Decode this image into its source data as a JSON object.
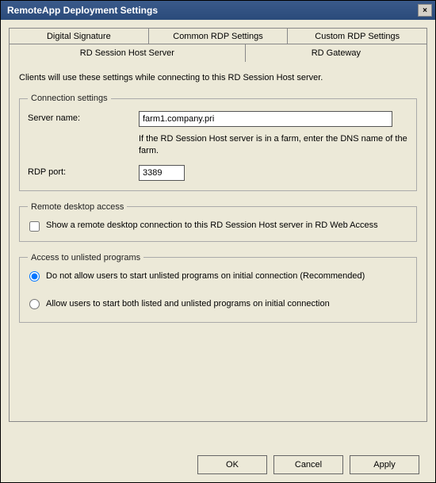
{
  "window": {
    "title": "RemoteApp Deployment Settings",
    "close_label": "×"
  },
  "tabs": {
    "row1": [
      "Digital Signature",
      "Common RDP Settings",
      "Custom RDP Settings"
    ],
    "row2": [
      "RD Session Host Server",
      "RD Gateway"
    ]
  },
  "panel": {
    "description": "Clients will use these settings while connecting to this RD Session Host server."
  },
  "connection": {
    "legend": "Connection settings",
    "server_label": "Server name:",
    "server_value": "farm1.company.pri",
    "server_hint": "If the RD Session Host server is in a farm, enter the DNS name of the farm.",
    "port_label": "RDP port:",
    "port_value": "3389"
  },
  "remote_access": {
    "legend": "Remote desktop access",
    "checkbox_label": "Show a remote desktop connection to this RD Session Host server in RD Web Access",
    "checked": false
  },
  "unlisted": {
    "legend": "Access to unlisted programs",
    "option1": "Do not allow users to start unlisted programs on initial connection (Recommended)",
    "option2": "Allow users to start both listed and unlisted programs on initial connection",
    "selected": 0
  },
  "buttons": {
    "ok": "OK",
    "cancel": "Cancel",
    "apply": "Apply"
  }
}
